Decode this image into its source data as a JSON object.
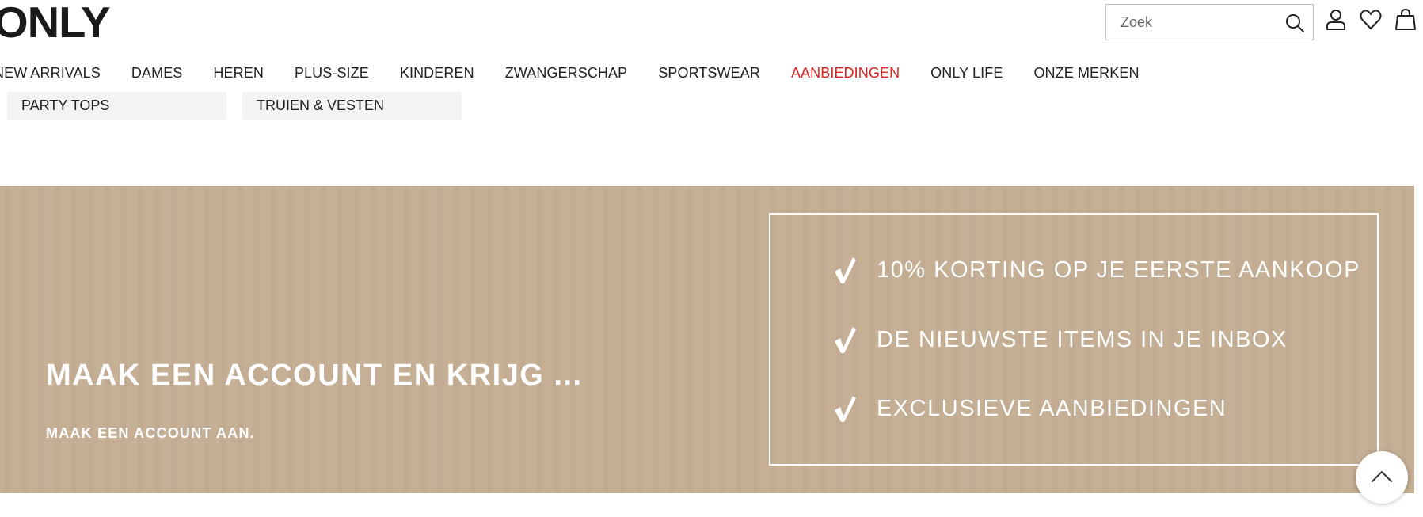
{
  "header": {
    "logo_text": "ONLY",
    "search": {
      "placeholder": "Zoek",
      "value": ""
    },
    "icons": [
      "search-icon",
      "account-icon",
      "heart-icon",
      "bag-icon"
    ]
  },
  "nav": {
    "items": [
      {
        "label": "NEW ARRIVALS"
      },
      {
        "label": "DAMES"
      },
      {
        "label": "HEREN"
      },
      {
        "label": "PLUS-SIZE"
      },
      {
        "label": "KINDEREN"
      },
      {
        "label": "ZWANGERSCHAP"
      },
      {
        "label": "SPORTSWEAR"
      },
      {
        "label": "AANBIEDINGEN"
      },
      {
        "label": "ONLY LIFE"
      },
      {
        "label": "ONZE MERKEN"
      }
    ]
  },
  "chips": [
    {
      "label": "PARTY TOPS"
    },
    {
      "label": "TRUIEN & VESTEN"
    }
  ],
  "banner": {
    "title": "MAAK EEN ACCOUNT EN KRIJG ...",
    "cta": "MAAK EEN ACCOUNT AAN.",
    "benefits": [
      {
        "text": "10% KORTING OP JE EERSTE AANKOOP"
      },
      {
        "text": "DE NIEUWSTE ITEMS IN JE INBOX"
      },
      {
        "text": "EXCLUSIEVE AANBIEDINGEN"
      }
    ]
  },
  "colors": {
    "sale": "#d8231f",
    "banner_bg": "#c4ae94",
    "text": "#222222"
  },
  "scroll_top_icon": "chevron-up-icon"
}
